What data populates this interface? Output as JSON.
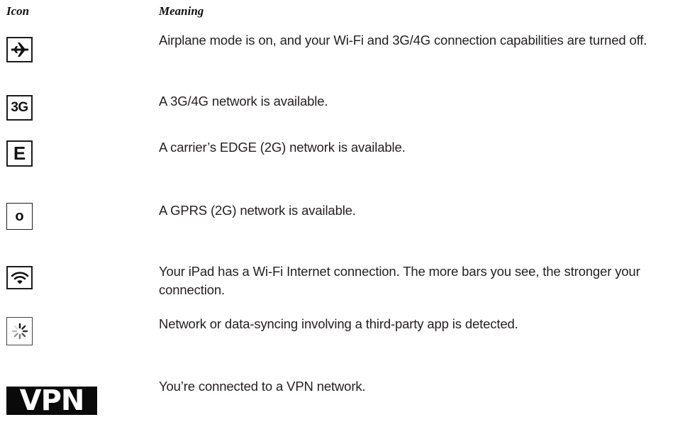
{
  "table": {
    "headers": {
      "icon": "Icon",
      "meaning": "Meaning"
    },
    "rows": [
      {
        "icon_name": "airplane-icon",
        "meaning": "Airplane mode is on, and your Wi-Fi and 3G/4G connection capabilities are turned off."
      },
      {
        "icon_name": "3g-icon",
        "icon_text": "3G",
        "meaning": "A 3G/4G network is available."
      },
      {
        "icon_name": "edge-icon",
        "icon_text": "E",
        "meaning": "A carrier’s EDGE (2G) network is available."
      },
      {
        "icon_name": "gprs-icon",
        "icon_text": "o",
        "meaning": "A GPRS (2G) network is available."
      },
      {
        "icon_name": "wifi-icon",
        "meaning": "Your iPad has a Wi-Fi Internet connection. The more bars you see, the stronger your connection."
      },
      {
        "icon_name": "syncing-spinner-icon",
        "meaning": "Network or data-syncing involving a third-party app is detected."
      },
      {
        "icon_name": "vpn-icon",
        "icon_text": "VPN",
        "meaning": "You’re connected to a VPN network."
      }
    ]
  }
}
